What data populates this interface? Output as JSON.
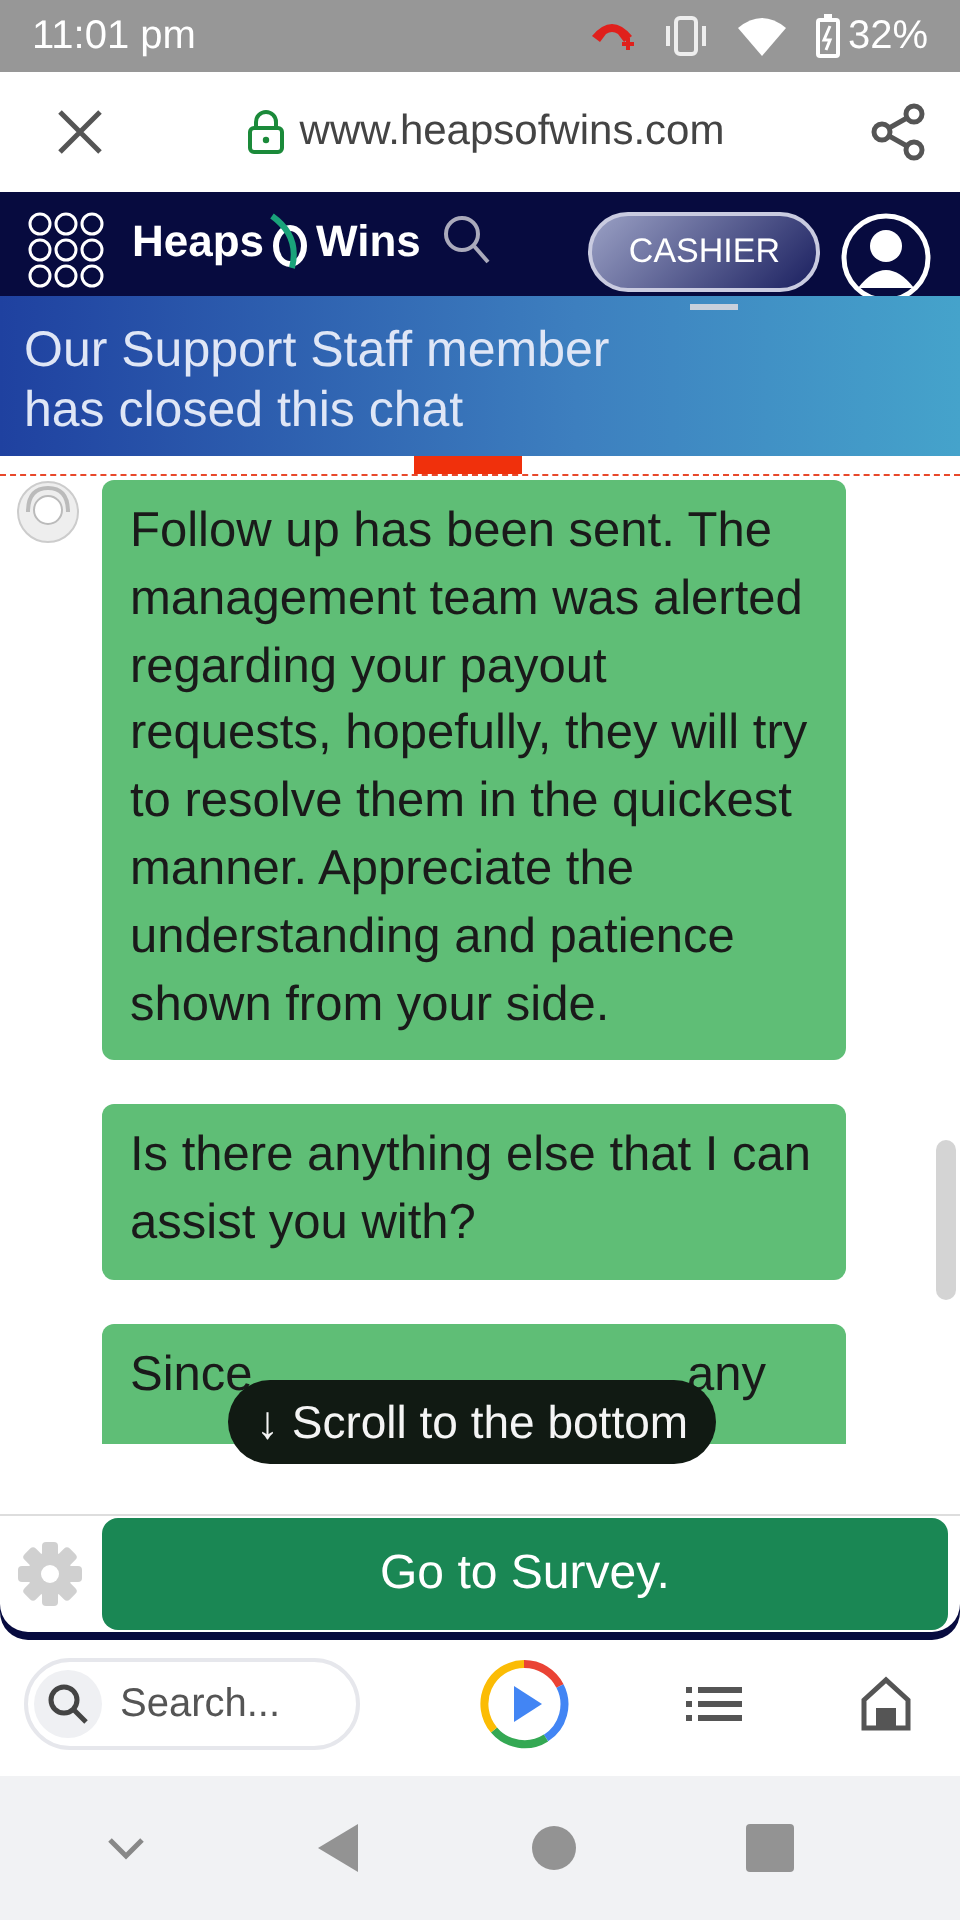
{
  "status_bar": {
    "time": "11:01 pm",
    "battery": "32%"
  },
  "browser_bar": {
    "url": "www.heapsofwins.com"
  },
  "site_header": {
    "logo_left": "Heaps",
    "logo_right": "Wins",
    "cashier": "CASHIER"
  },
  "chat_banner": {
    "text": "Our Support Staff member has closed this chat"
  },
  "messages": [
    {
      "kind": "full",
      "text": "Follow up has been sent. The management team was alerted regarding your payout requests, hopefully, they will try to resolve them in the quickest manner. Appreciate the understanding and patience shown from your side.",
      "avatar": true
    },
    {
      "kind": "full",
      "text": "Is there anything else that I can assist you with?",
      "avatar": false
    },
    {
      "kind": "partial",
      "parts": [
        "Since",
        "any"
      ],
      "avatar": false
    }
  ],
  "scroll_pill": {
    "text": "↓ Scroll to the bottom"
  },
  "survey_button": "Go to Survey.",
  "bottom_bar": {
    "search_placeholder": "Search..."
  }
}
